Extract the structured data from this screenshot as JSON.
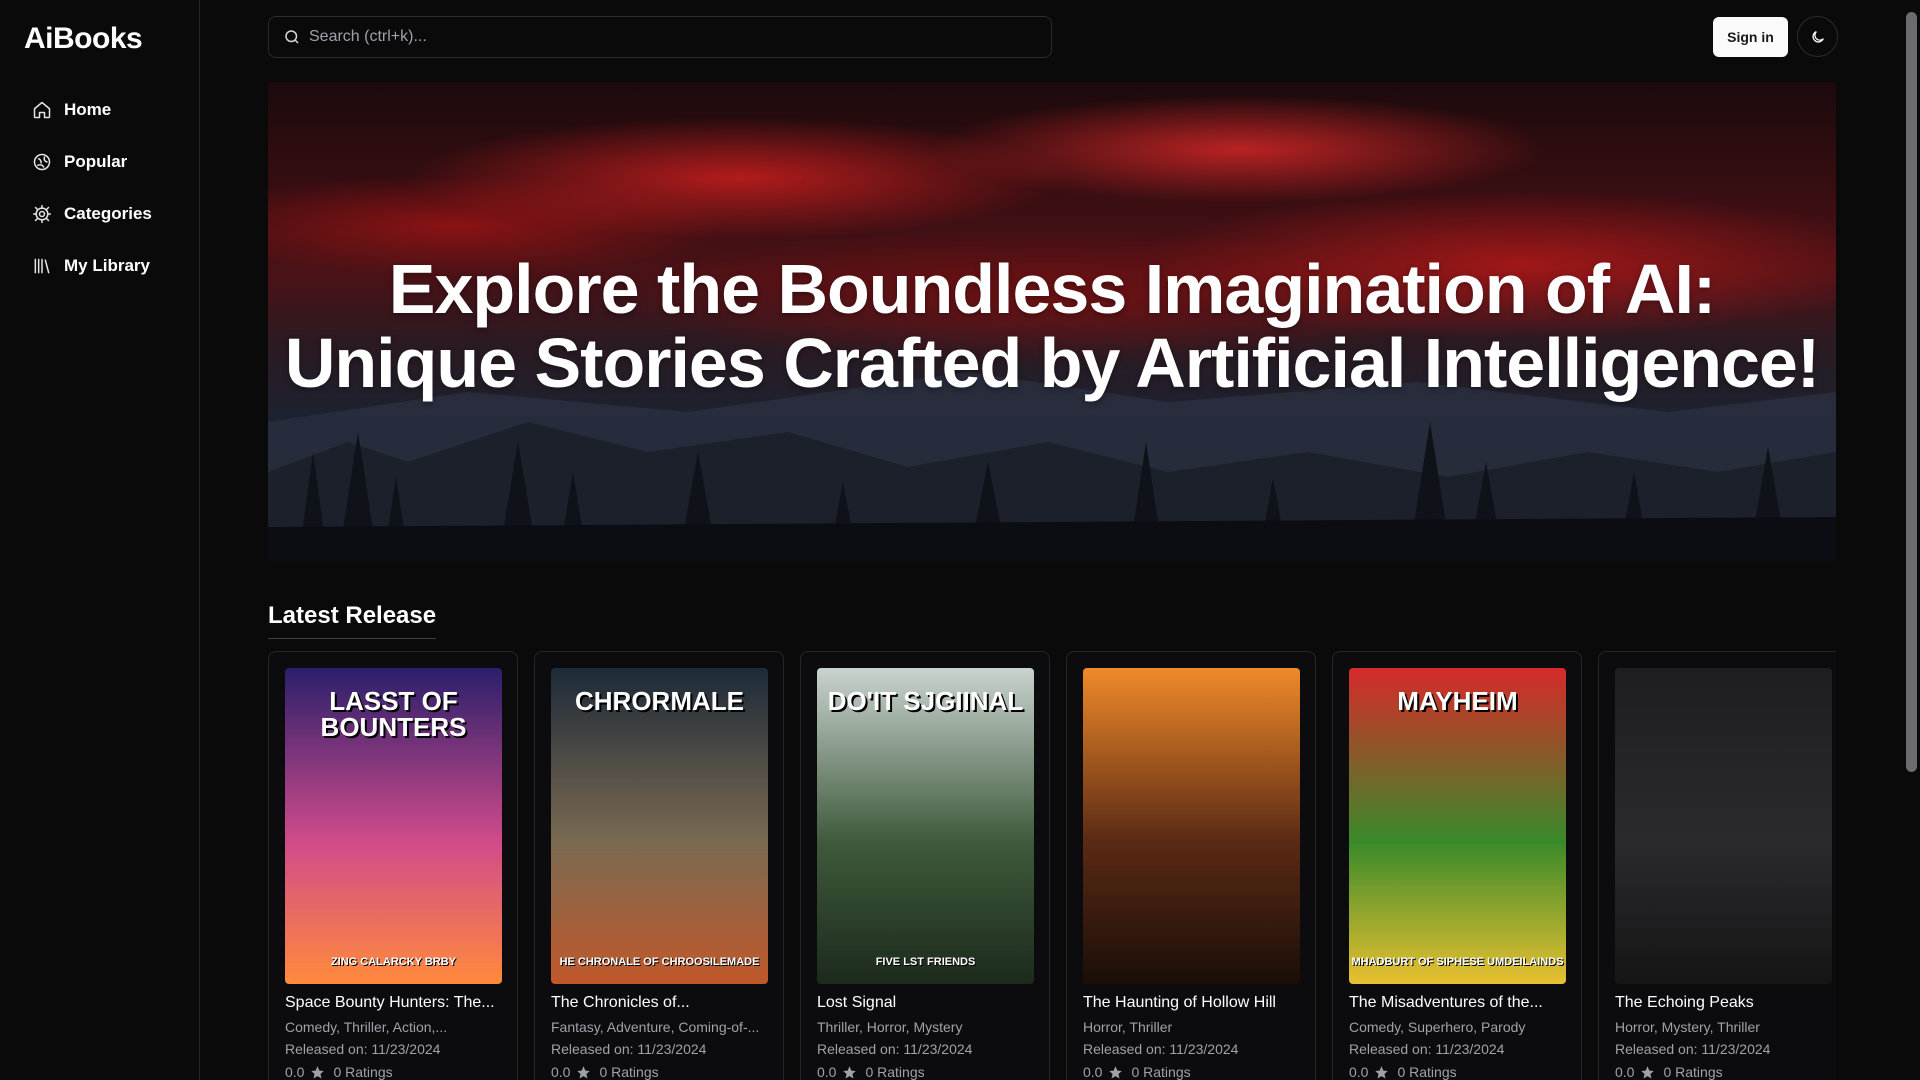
{
  "app": {
    "logo": "AiBooks"
  },
  "sidebar": {
    "items": [
      {
        "label": "Home",
        "icon": "home-icon"
      },
      {
        "label": "Popular",
        "icon": "popular-icon"
      },
      {
        "label": "Categories",
        "icon": "gear-icon"
      },
      {
        "label": "My Library",
        "icon": "library-icon"
      }
    ]
  },
  "search": {
    "placeholder": "Search (ctrl+k)..."
  },
  "header": {
    "signin_label": "Sign in",
    "theme_icon": "moon-icon"
  },
  "hero": {
    "title": "Explore the Boundless Imagination of AI: Unique Stories Crafted by Artificial Intelligence!"
  },
  "section": {
    "title": "Latest Release"
  },
  "books": [
    {
      "title": "Space Bounty Hunters: The...",
      "genres": "Comedy, Thriller, Action,...",
      "released": "Released on: 11/23/2024",
      "rating": "0.0",
      "ratings_count": "0 Ratings",
      "cover_top": "LASST OF BOUNTERS",
      "cover_bottom": "ZING CALARCKY BRBY",
      "cover_colors": [
        "#2a1f6b",
        "#d14b8a",
        "#ff8a3c"
      ]
    },
    {
      "title": "The Chronicles of...",
      "genres": "Fantasy, Adventure, Coming-of-...",
      "released": "Released on: 11/23/2024",
      "rating": "0.0",
      "ratings_count": "0 Ratings",
      "cover_top": "CHRORMALE",
      "cover_bottom": "HE CHRONALE OF CHROOSILEMADE",
      "cover_colors": [
        "#1d2a38",
        "#7a6a52",
        "#c0582a"
      ]
    },
    {
      "title": "Lost Signal",
      "genres": "Thriller, Horror, Mystery",
      "released": "Released on: 11/23/2024",
      "rating": "0.0",
      "ratings_count": "0 Ratings",
      "cover_top": "DO'IT SJGIINAL",
      "cover_bottom": "FIVE LST FRIENDS",
      "cover_colors": [
        "#c9d3cf",
        "#3f5a3c",
        "#1c2a1c"
      ]
    },
    {
      "title": "The Haunting of Hollow Hill",
      "genres": "Horror, Thriller",
      "released": "Released on: 11/23/2024",
      "rating": "0.0",
      "ratings_count": "0 Ratings",
      "cover_top": "",
      "cover_bottom": "",
      "cover_colors": [
        "#f08a2a",
        "#5a2a14",
        "#1a0e08"
      ]
    },
    {
      "title": "The Misadventures of the...",
      "genres": "Comedy, Superhero, Parody",
      "released": "Released on: 11/23/2024",
      "rating": "0.0",
      "ratings_count": "0 Ratings",
      "cover_top": "MAYHEIM",
      "cover_bottom": "MHADBURT OF SIPHESE UMDEILAINDS",
      "cover_colors": [
        "#d62a2a",
        "#3a8a2a",
        "#e8c030"
      ]
    },
    {
      "title": "The Echoing Peaks",
      "genres": "Horror, Mystery, Thriller",
      "released": "Released on: 11/23/2024",
      "rating": "0.0",
      "ratings_count": "0 Ratings",
      "cover_top": "",
      "cover_bottom": "",
      "cover_colors": [
        "#1e1e20",
        "#2a2a2c",
        "#151516"
      ]
    }
  ]
}
